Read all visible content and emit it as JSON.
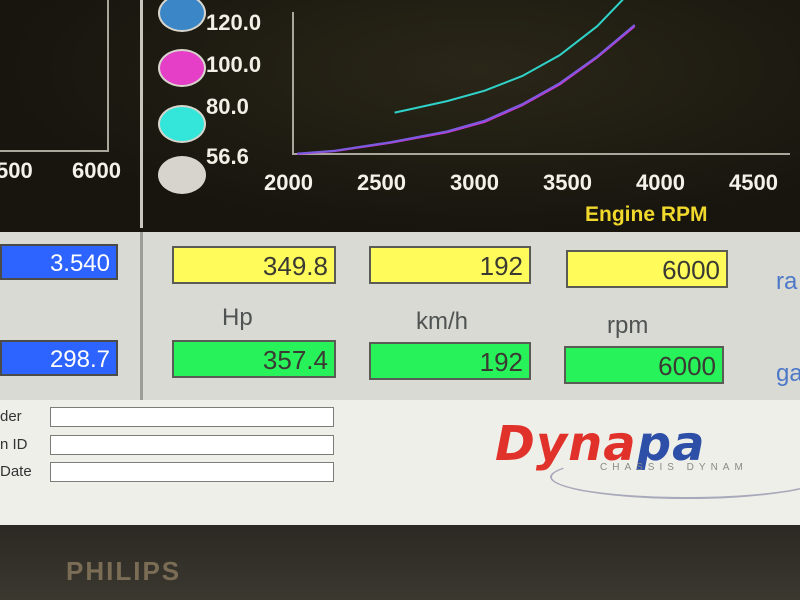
{
  "left_chart": {
    "x_ticks": [
      "500",
      "6000"
    ]
  },
  "legend": {
    "items": [
      {
        "icon": "globe-icon",
        "color": "#2e6fd1",
        "fill": "#3b86c7"
      },
      {
        "icon": "color-dot-icon",
        "color": "#e23fc4",
        "fill": "#e43fc6"
      },
      {
        "icon": "color-dot-icon",
        "color": "#2fe6d8",
        "fill": "#33e6d9"
      },
      {
        "icon": "color-dot-icon",
        "color": "#d6d4cc",
        "fill": "#d6d4cc"
      }
    ]
  },
  "chart_data": {
    "type": "line",
    "xlabel": "Engine RPM",
    "x_ticks": [
      "2000",
      "2500",
      "3000",
      "3500",
      "4000",
      "4500"
    ],
    "y_ticks": [
      "120.0",
      "100.0",
      "80.0",
      "56.6"
    ],
    "xlim": [
      2000,
      4700
    ],
    "ylim": [
      56.6,
      130
    ],
    "series": [
      {
        "color": "#2fd3c9",
        "x": [
          2520,
          2600,
          2800,
          3000,
          3200,
          3400,
          3600,
          3750
        ],
        "y": [
          76.5,
          78,
          82,
          87,
          94,
          104,
          118,
          132
        ]
      },
      {
        "color": "#c83ad0",
        "x": [
          2000,
          2200,
          2500,
          2800,
          3000,
          3200,
          3400,
          3600,
          3800
        ],
        "y": [
          56.6,
          58,
          62,
          67,
          72,
          80,
          90,
          103,
          118
        ]
      },
      {
        "color": "#7a5be0",
        "x": [
          2000,
          2200,
          2500,
          2800,
          3000,
          3200,
          3400,
          3600,
          3800
        ],
        "y": [
          56.8,
          58.2,
          62.3,
          67.5,
          72.6,
          80.5,
          90.6,
          103.5,
          118.6
        ]
      }
    ],
    "grid": false,
    "legend": "left"
  },
  "left_readouts": {
    "top": "3.540",
    "bottom": "298.7"
  },
  "readouts": {
    "yellow": [
      {
        "value": "349.8"
      },
      {
        "value": "192"
      },
      {
        "value": "6000"
      }
    ],
    "green": [
      {
        "value": "357.4"
      },
      {
        "value": "192"
      },
      {
        "value": "6000"
      }
    ],
    "units": [
      "Hp",
      "km/h",
      "rpm"
    ],
    "edge_labels": [
      "ra",
      "ga"
    ]
  },
  "form": {
    "fields": [
      {
        "label": "der",
        "value": ""
      },
      {
        "label": "n ID",
        "value": ""
      },
      {
        "label": "Date",
        "value": ""
      }
    ]
  },
  "logo": {
    "part1": "Dyna",
    "part2": "pa",
    "subtitle": "CHASSIS DYNAM"
  },
  "monitor": {
    "brand": "PHILIPS"
  }
}
